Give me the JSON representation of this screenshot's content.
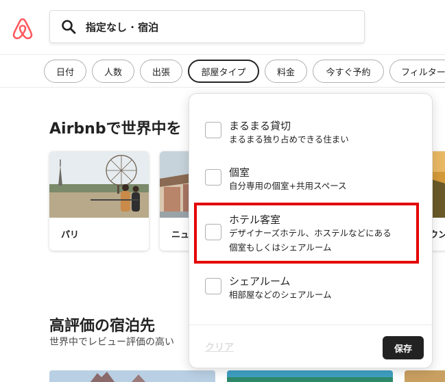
{
  "header": {
    "logo_icon": "airbnb-logo",
    "search": {
      "icon": "search-icon",
      "text": "指定なし · 宿泊"
    }
  },
  "filters": [
    {
      "label": "日付"
    },
    {
      "label": "人数"
    },
    {
      "label": "出張"
    },
    {
      "label": "部屋タイプ",
      "active": true
    },
    {
      "label": "料金"
    },
    {
      "label": "今すぐ予約"
    },
    {
      "label": "フィルター"
    }
  ],
  "main": {
    "section1_title": "Airbnbで世界中を",
    "cards": [
      {
        "label": "パリ"
      },
      {
        "label": "ニュ"
      },
      {
        "label": "ウン"
      }
    ],
    "section2_title": "高評価の宿泊先",
    "section2_sub": "世界中でレビュー評価の高い"
  },
  "dropdown": {
    "options": [
      {
        "title": "まるまる貸切",
        "desc": [
          "まるまる独り占めできる住まい"
        ],
        "checked": false
      },
      {
        "title": "個室",
        "desc": [
          "自分専用の個室+共用スペース"
        ],
        "checked": false
      },
      {
        "title": "ホテル客室",
        "desc": [
          "デザイナーズホテル、ホステルなどにある",
          "個室もしくはシェアルーム"
        ],
        "checked": false
      },
      {
        "title": "シェアルーム",
        "desc": [
          "相部屋などのシェアルーム"
        ],
        "checked": false
      }
    ],
    "clear_label": "クリア",
    "save_label": "保存"
  },
  "colors": {
    "brand": "#FF5A5F",
    "highlight": "#E40000",
    "save_bg": "#222222"
  }
}
